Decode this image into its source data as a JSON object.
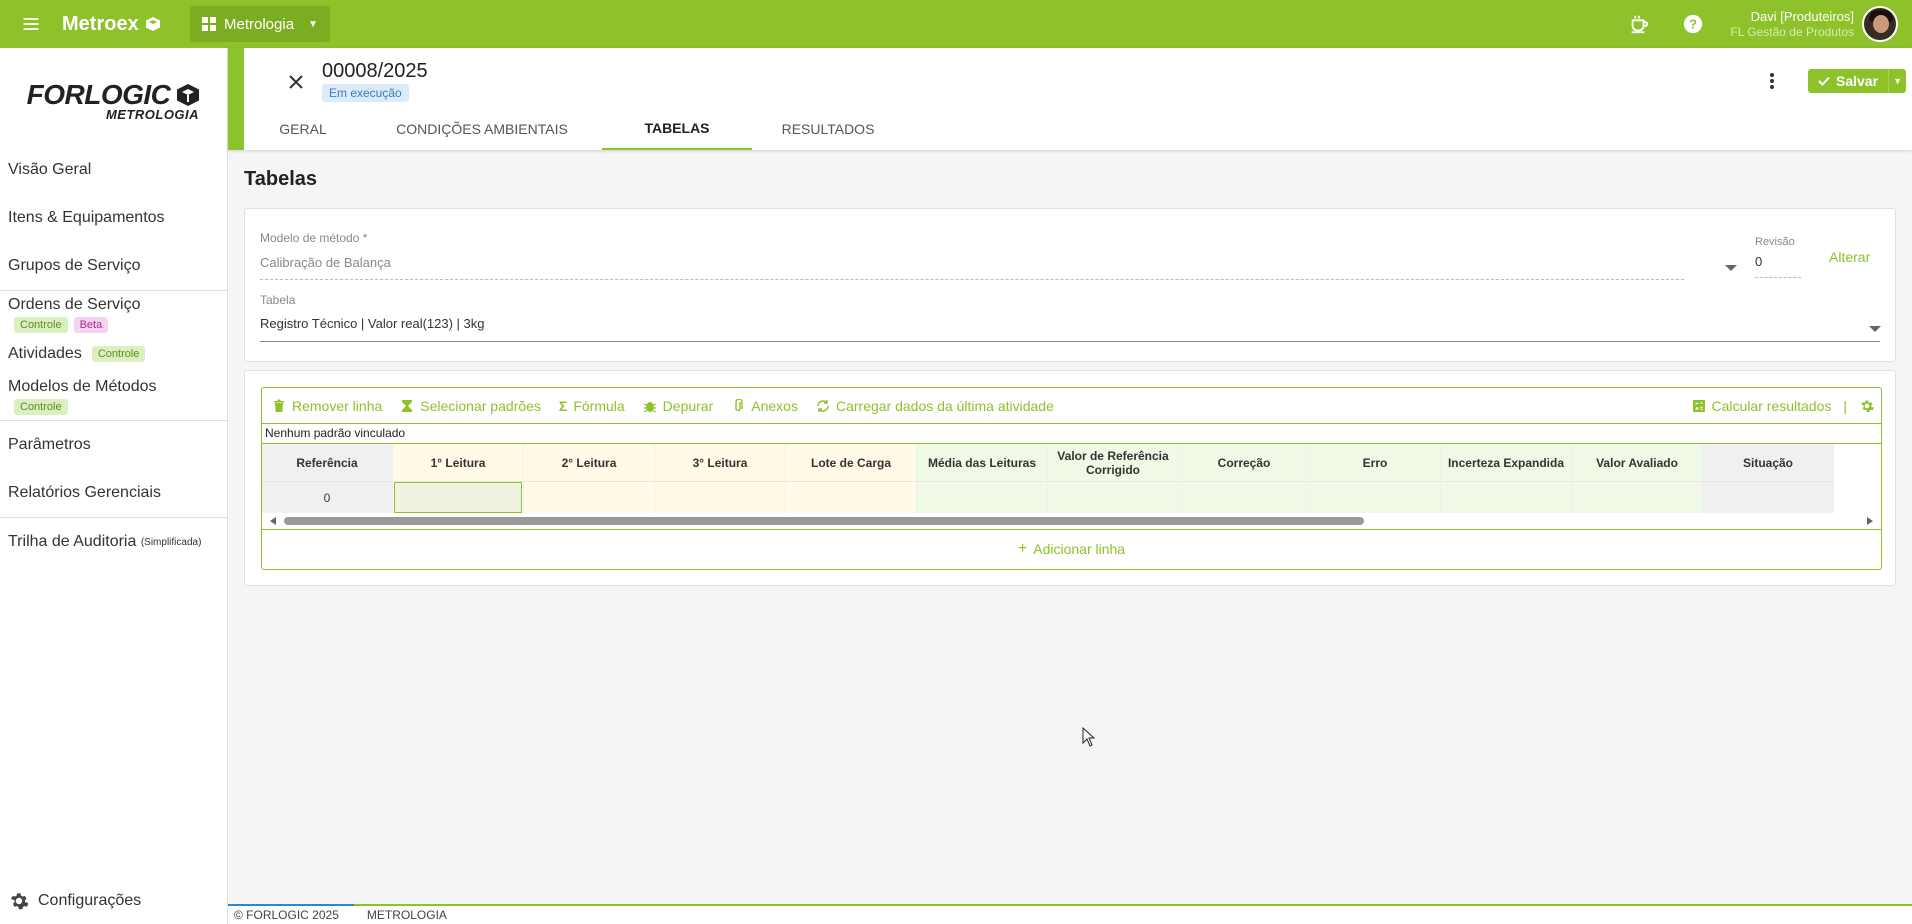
{
  "topbar": {
    "brand": "Metroex",
    "module": "Metrologia",
    "user_name": "Davi [Produteiros]",
    "user_org": "FL Gestão de Produtos"
  },
  "sidebar": {
    "logo_main": "FORLOGIC",
    "logo_sub": "METROLOGIA",
    "items": [
      {
        "label": "Visão Geral"
      },
      {
        "label": "Itens & Equipamentos"
      },
      {
        "label": "Grupos de Serviço"
      },
      {
        "label": "Ordens de Serviço",
        "tags": [
          "Controle",
          "Beta"
        ]
      },
      {
        "label": "Atividades",
        "tags": [
          "Controle"
        ]
      },
      {
        "label": "Modelos de Métodos",
        "tags": [
          "Controle"
        ]
      },
      {
        "label": "Parâmetros"
      },
      {
        "label": "Relatórios Gerenciais"
      },
      {
        "label": "Trilha de Auditoria",
        "small": "(Simplificada)"
      }
    ],
    "config": "Configurações"
  },
  "header": {
    "doc_number": "00008/2025",
    "status": "Em execução",
    "save_label": "Salvar",
    "tabs": [
      {
        "label": "GERAL"
      },
      {
        "label": "CONDIÇÕES AMBIENTAIS"
      },
      {
        "label": "TABELAS",
        "active": true
      },
      {
        "label": "RESULTADOS"
      }
    ]
  },
  "main": {
    "title": "Tabelas",
    "method_model_label": "Modelo de método *",
    "method_model_value": "Calibração de Balança",
    "revision_label": "Revisão",
    "revision_value": "0",
    "alter_label": "Alterar",
    "table_label": "Tabela",
    "table_value": "Registro Técnico | Valor real(123) | 3kg"
  },
  "toolbar": {
    "remove_line": "Remover linha",
    "select_standards": "Selecionar padrões",
    "formula": "Fórmula",
    "debug": "Depurar",
    "attachments": "Anexos",
    "load_last": "Carregar dados da última atividade",
    "calculate": "Calcular resultados",
    "separator": "|"
  },
  "grid": {
    "no_standard": "Nenhum padrão vinculado",
    "columns": [
      {
        "label": "Referência",
        "cell": "0",
        "bg": "grey"
      },
      {
        "label": "1° Leitura",
        "cell": "",
        "bg": "selected"
      },
      {
        "label": "2° Leitura",
        "cell": "",
        "bg": "yellow"
      },
      {
        "label": "3° Leitura",
        "cell": "",
        "bg": "yellow"
      },
      {
        "label": "Lote de Carga",
        "cell": "",
        "bg": "yellow"
      },
      {
        "label": "Média das Leituras",
        "cell": "",
        "bg": "green"
      },
      {
        "label": "Valor de Referência Corrigido",
        "cell": "",
        "bg": "green"
      },
      {
        "label": "Correção",
        "cell": "",
        "bg": "green"
      },
      {
        "label": "Erro",
        "cell": "",
        "bg": "green"
      },
      {
        "label": "Incerteza Expandida",
        "cell": "",
        "bg": "green"
      },
      {
        "label": "Valor Avaliado",
        "cell": "",
        "bg": "green"
      },
      {
        "label": "Situação",
        "cell": "",
        "bg": "grey"
      }
    ],
    "add_line": "Adicionar linha"
  },
  "footer": {
    "copyright": "© FORLOGIC 2025",
    "module": "METROLOGIA"
  },
  "colors": {
    "accent": "#8dc22b",
    "badge_blue": "#3a78c2",
    "beta_pink": "#b12a98"
  }
}
